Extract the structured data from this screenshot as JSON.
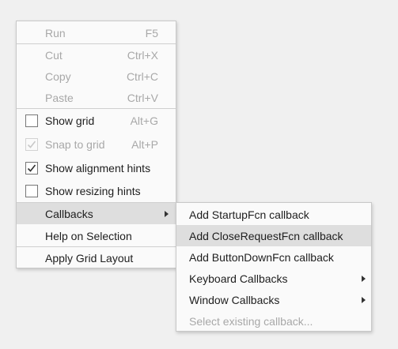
{
  "main_menu": {
    "run": {
      "label": "Run",
      "shortcut": "F5"
    },
    "cut": {
      "label": "Cut",
      "shortcut": "Ctrl+X"
    },
    "copy": {
      "label": "Copy",
      "shortcut": "Ctrl+C"
    },
    "paste": {
      "label": "Paste",
      "shortcut": "Ctrl+V"
    },
    "show_grid": {
      "label": "Show grid",
      "shortcut": "Alt+G",
      "checked": false
    },
    "snap_to_grid": {
      "label": "Snap to grid",
      "shortcut": "Alt+P",
      "checked": true
    },
    "show_alignment_hints": {
      "label": "Show alignment hints",
      "checked": true
    },
    "show_resizing_hints": {
      "label": "Show resizing hints",
      "checked": false
    },
    "callbacks": {
      "label": "Callbacks"
    },
    "help_on_selection": {
      "label": "Help on Selection"
    },
    "apply_grid_layout": {
      "label": "Apply Grid Layout"
    }
  },
  "callbacks_submenu": {
    "add_startup": {
      "label": "Add StartupFcn callback"
    },
    "add_closerequest": {
      "label": "Add CloseRequestFcn callback"
    },
    "add_buttondown": {
      "label": "Add ButtonDownFcn callback"
    },
    "keyboard_callbacks": {
      "label": "Keyboard Callbacks"
    },
    "window_callbacks": {
      "label": "Window Callbacks"
    },
    "select_existing": {
      "label": "Select existing callback..."
    }
  }
}
